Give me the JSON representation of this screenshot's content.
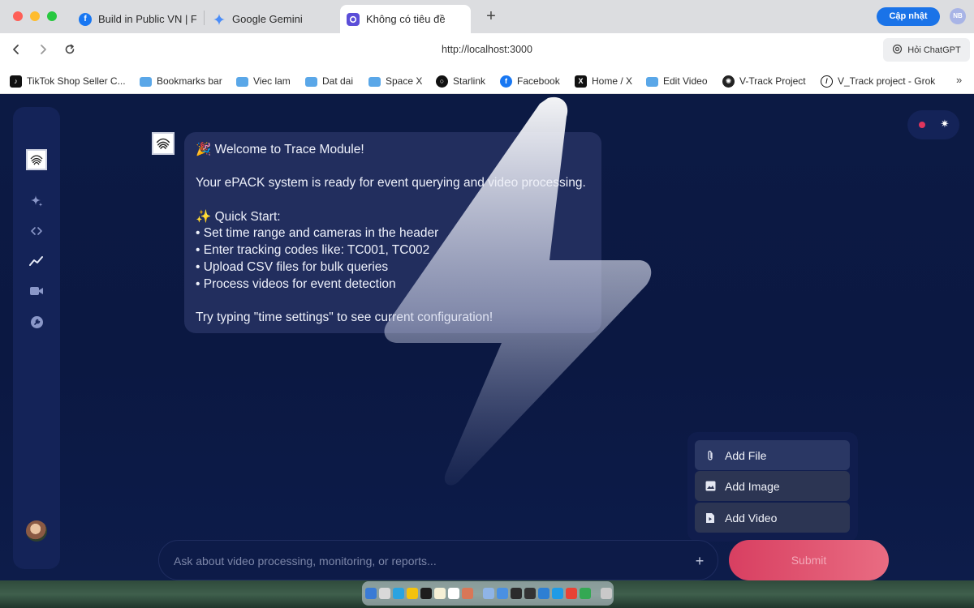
{
  "browser": {
    "tabs": [
      {
        "title": "Build in Public VN | Fa",
        "icon": "facebook-icon"
      },
      {
        "title": "Google Gemini",
        "icon": "gemini-icon"
      },
      {
        "title": "Không có tiêu đề",
        "icon": "app-icon"
      }
    ],
    "update_label": "Cập nhật",
    "profile_initials": "NB",
    "url": "http://localhost:3000",
    "ask_chatgpt_label": "Hỏi ChatGPT",
    "bookmarks": [
      {
        "label": "TikTok Shop Seller C...",
        "icon": "tiktok-icon"
      },
      {
        "label": "Bookmarks bar",
        "icon": "folder-icon"
      },
      {
        "label": "Viec lam",
        "icon": "folder-icon"
      },
      {
        "label": "Dat dai",
        "icon": "folder-icon"
      },
      {
        "label": "Space X",
        "icon": "folder-icon"
      },
      {
        "label": "Starlink",
        "icon": "starlink-icon"
      },
      {
        "label": "Facebook",
        "icon": "facebook-icon"
      },
      {
        "label": "Home / X",
        "icon": "x-icon"
      },
      {
        "label": "Edit Video",
        "icon": "folder-icon"
      },
      {
        "label": "V-Track Project",
        "icon": "openai-icon"
      },
      {
        "label": "V_Track project - Grok",
        "icon": "grok-icon"
      }
    ],
    "more_bookmarks": "»"
  },
  "chat": {
    "welcome_lines": [
      "🎉 Welcome to Trace Module!",
      "",
      "Your ePACK system is ready for event querying and video processing.",
      "",
      "✨ Quick Start:",
      "• Set time range and cameras in the header",
      "• Enter tracking codes like: TC001, TC002",
      "• Upload CSV files for bulk queries",
      "• Process videos for event detection",
      "",
      "Try typing \"time settings\" to see current configuration!"
    ]
  },
  "attach_menu": {
    "items": [
      {
        "label": "Add File",
        "icon": "paperclip-icon"
      },
      {
        "label": "Add Image",
        "icon": "image-icon"
      },
      {
        "label": "Add Video",
        "icon": "video-file-icon"
      }
    ]
  },
  "composer": {
    "placeholder": "Ask about video processing, monitoring, or reports...",
    "plus_label": "+",
    "submit_label": "Submit"
  },
  "theme": {
    "accent": "#e0355d",
    "background": "#0b1842"
  }
}
